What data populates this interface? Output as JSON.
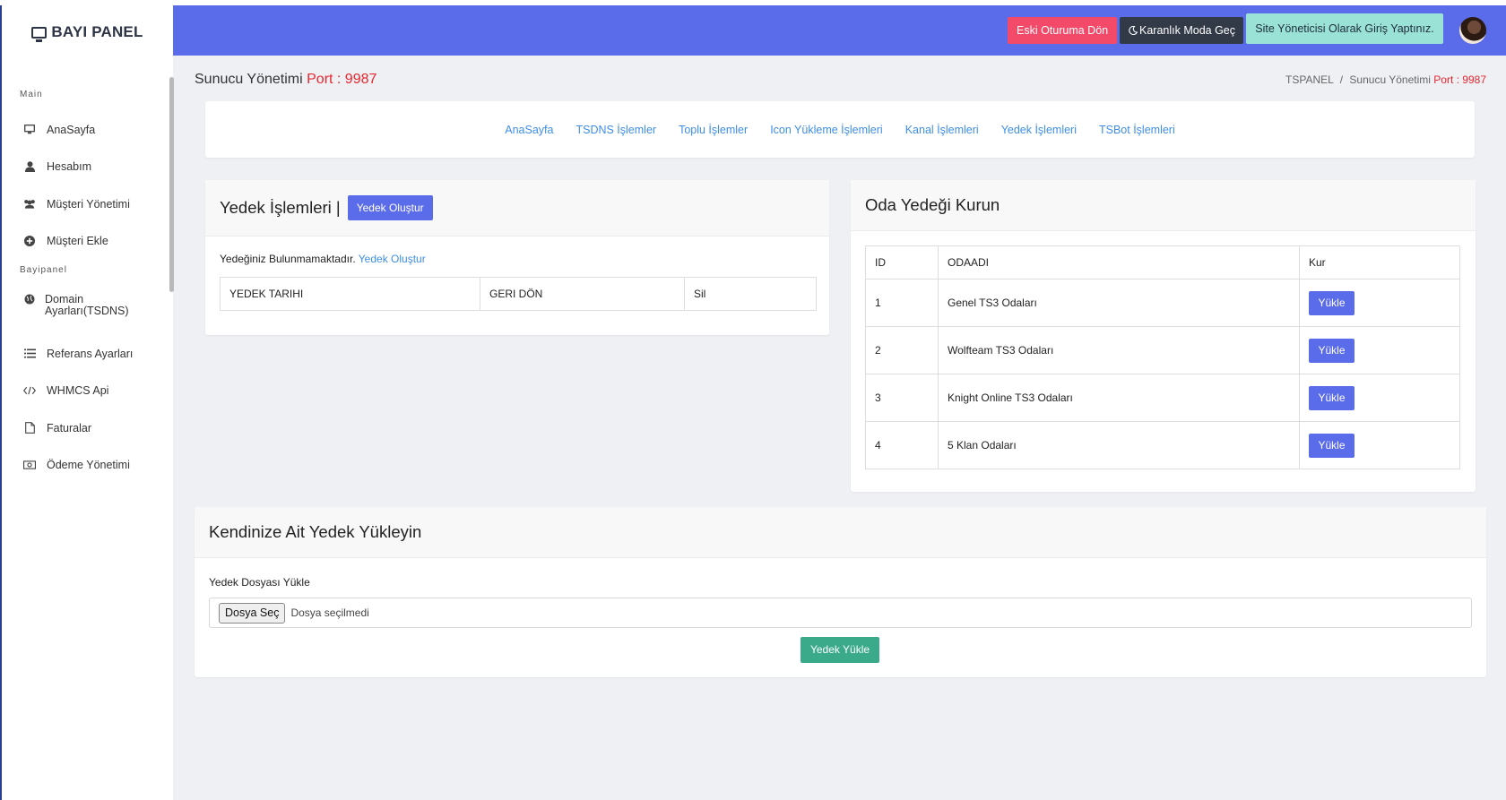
{
  "sidebar": {
    "brand": "BAYI PANEL",
    "heading_main": "Main",
    "heading_bayi": "Bayipanel",
    "items": [
      {
        "label": "AnaSayfa",
        "icon": "monitor-icon"
      },
      {
        "label": "Hesabım",
        "icon": "user-icon"
      },
      {
        "label": "Müşteri Yönetimi",
        "icon": "users-icon"
      },
      {
        "label": "Müşteri Ekle",
        "icon": "plus-circle-icon"
      },
      {
        "label": "Domain Ayarları(TSDNS)",
        "icon": "globe-icon"
      },
      {
        "label": "Referans Ayarları",
        "icon": "list-icon"
      },
      {
        "label": "WHMCS Api",
        "icon": "code-icon"
      },
      {
        "label": "Faturalar",
        "icon": "file-icon"
      },
      {
        "label": "Ödeme Yönetimi",
        "icon": "money-icon"
      }
    ]
  },
  "topbar": {
    "old_session": "Eski Oturuma Dön",
    "dark_mode": "Karanlık Moda Geç",
    "admin_login": "Site Yöneticisi Olarak Giriş Yaptınız."
  },
  "header": {
    "title": "Sunucu Yönetimi",
    "port_label": "Port : 9987",
    "breadcrumb_root": "TSPANEL",
    "breadcrumb_sep": "/",
    "breadcrumb_current": "Sunucu Yönetimi",
    "breadcrumb_port": "Port : 9987"
  },
  "nav_links": [
    "AnaSayfa",
    "TSDNS İşlemler",
    "Toplu İşlemler",
    "Icon Yükleme İşlemleri",
    "Kanal İşlemleri",
    "Yedek İşlemleri",
    "TSBot İşlemleri"
  ],
  "backups": {
    "title": "Yedek İşlemleri |",
    "create_button": "Yedek Oluştur",
    "empty_text": "Yedeğiniz Bulunmamaktadır.",
    "empty_link": "Yedek Oluştur",
    "columns": [
      "YEDEK TARIHI",
      "GERI DÖN",
      "Sil"
    ]
  },
  "room_backups": {
    "title": "Oda Yedeği Kurun",
    "columns": [
      "ID",
      "ODAADI",
      "Kur"
    ],
    "rows": [
      {
        "id": "1",
        "name": "Genel TS3 Odaları",
        "action": "Yükle"
      },
      {
        "id": "2",
        "name": "Wolfteam TS3 Odaları",
        "action": "Yükle"
      },
      {
        "id": "3",
        "name": "Knight Online TS3 Odaları",
        "action": "Yükle"
      },
      {
        "id": "4",
        "name": "5 Klan Odaları",
        "action": "Yükle"
      }
    ]
  },
  "upload": {
    "title": "Kendinize Ait Yedek Yükleyin",
    "field_label": "Yedek Dosyası Yükle",
    "choose_button": "Dosya Seç",
    "no_file": "Dosya seçilmedi",
    "submit": "Yedek Yükle"
  },
  "colors": {
    "accent": "#5b6cea",
    "danger": "#f44a6a",
    "dark": "#323a47",
    "info": "#9be2d6",
    "success": "#3aaa8a",
    "link": "#3e8ee8",
    "port": "#e8262f"
  }
}
